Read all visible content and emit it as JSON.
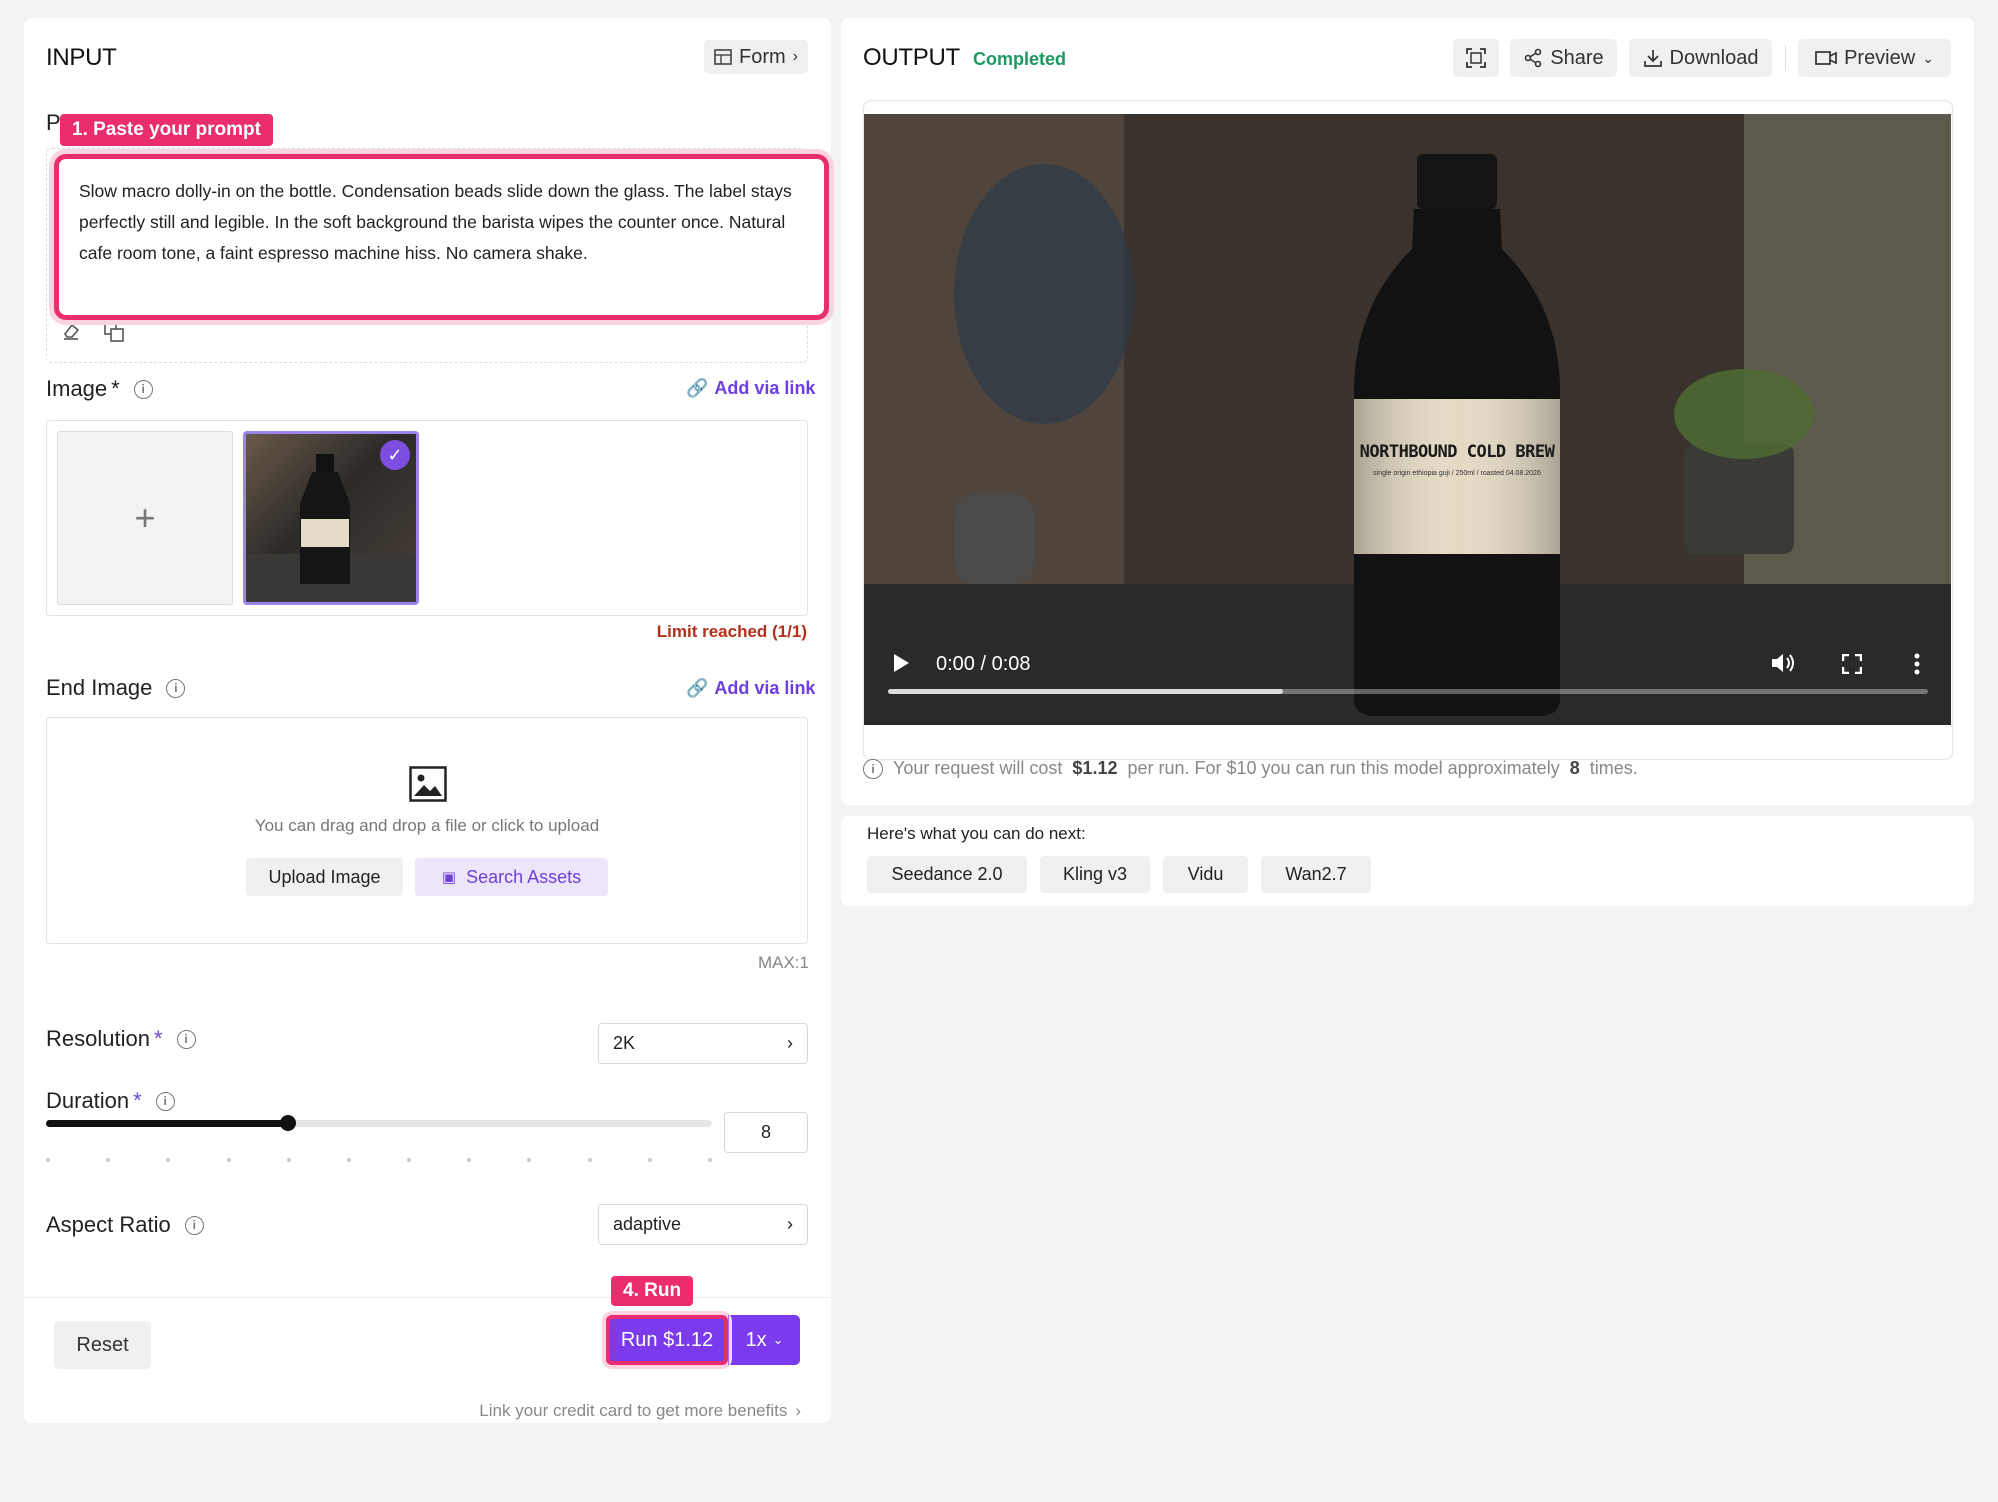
{
  "input": {
    "title": "INPUT",
    "form_toggle": "Form",
    "prompt": {
      "label": "P",
      "callout": "1. Paste your prompt",
      "value": "Slow macro dolly-in on the bottle. Condensation beads slide down the glass. The label stays perfectly still and legible. In the soft background the barista wipes the counter once. Natural cafe room tone, a faint espresso machine hiss. No camera shake."
    },
    "image": {
      "label": "Image",
      "required_mark": "*",
      "add_link": "Add via link",
      "limit_text": "Limit reached (1/1)"
    },
    "end_image": {
      "label": "End Image",
      "add_link": "Add via link",
      "hint": "You can drag and drop a file or click to upload",
      "upload_label": "Upload Image",
      "search_label": "Search Assets",
      "max_text": "MAX:1"
    },
    "resolution": {
      "label": "Resolution",
      "required_mark": "*",
      "value": "2K"
    },
    "duration": {
      "label": "Duration",
      "required_mark": "*",
      "value": "8",
      "level": 0.3636
    },
    "aspect_ratio": {
      "label": "Aspect Ratio",
      "value": "adaptive"
    },
    "footer": {
      "reset_label": "Reset",
      "run_callout": "4. Run",
      "run_label": "Run $1.12",
      "multiplier": "1x",
      "credit_link": "Link your credit card to get more benefits"
    }
  },
  "output": {
    "title": "OUTPUT",
    "status": "Completed",
    "share_label": "Share",
    "download_label": "Download",
    "preview_label": "Preview",
    "video": {
      "time": "0:00 / 0:08",
      "label_main": "NORTHBOUND COLD BREW",
      "label_sub": "single origin ethiopia guji / 250ml / roasted 04.08.2026",
      "buffered": 0.38
    },
    "cost": {
      "prefix": "Your request will cost",
      "price": "$1.12",
      "mid": "per run. For $10 you can run this model approximately",
      "count": "8",
      "suffix": "times."
    }
  },
  "next": {
    "heading": "Here's what you can do next:",
    "models": [
      "Seedance 2.0",
      "Kling v3",
      "Vidu",
      "Wan2.7"
    ]
  },
  "colors": {
    "accent": "#7c3aed",
    "highlight": "#ea2d6f",
    "success": "#1a9a5e"
  }
}
